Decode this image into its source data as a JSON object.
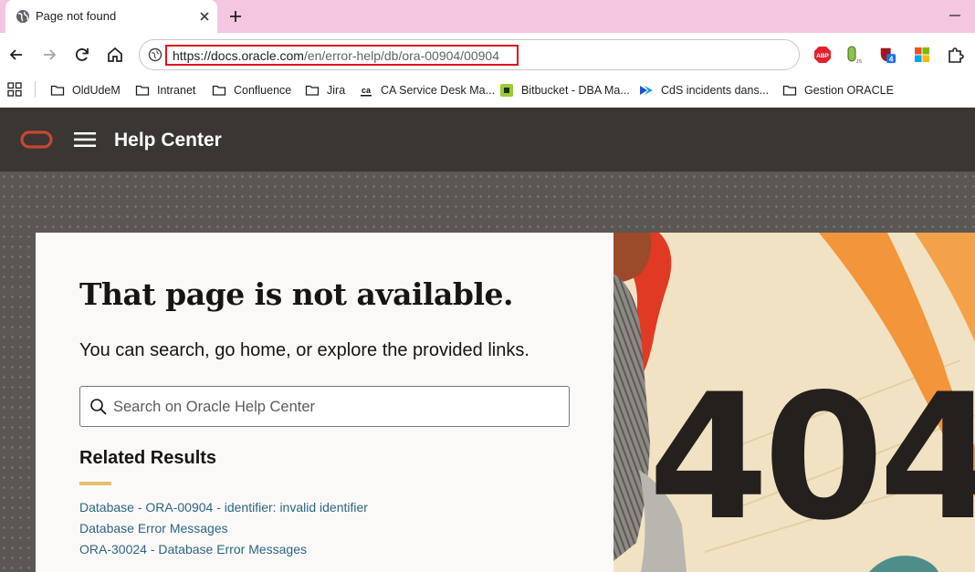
{
  "browser": {
    "tab": {
      "title": "Page not found"
    },
    "address_bar": {
      "url_host": "https://docs.oracle.com",
      "url_path": "/en/error-help/db/ora-00904/00904"
    },
    "bookmarks": [
      {
        "label": "OldUdeM",
        "icon": "folder-icon"
      },
      {
        "label": "Intranet",
        "icon": "folder-icon"
      },
      {
        "label": "Confluence",
        "icon": "folder-icon"
      },
      {
        "label": "Jira",
        "icon": "folder-icon"
      },
      {
        "label": "CA Service Desk Ma...",
        "icon": "ca-icon"
      },
      {
        "label": "Bitbucket - DBA Ma...",
        "icon": "bitbucket-icon"
      },
      {
        "label": "CdS incidents dans...",
        "icon": "cds-icon"
      },
      {
        "label": "Gestion ORACLE",
        "icon": "folder-icon"
      }
    ],
    "extensions": [
      {
        "name": "adblock-plus-icon",
        "label": "ABP"
      },
      {
        "name": "node-js-extension-icon",
        "label": "JS"
      },
      {
        "name": "shield-extension-icon",
        "badge": "4"
      },
      {
        "name": "microsoft-icon"
      },
      {
        "name": "extensions-puzzle-icon"
      }
    ]
  },
  "site": {
    "header_title": "Help Center"
  },
  "error_page": {
    "headline": "That page is not available.",
    "subline": "You can search, go home, or explore the provided links.",
    "search_placeholder": "Search on Oracle Help Center",
    "related_title": "Related Results",
    "related_links": [
      "Database - ORA-00904 - identifier: invalid identifier",
      "Database Error Messages",
      "ORA-30024 - Database Error Messages"
    ],
    "illustration_text": "404"
  },
  "colors": {
    "tabstrip": "#f4c6df",
    "oracle_red": "#c74634",
    "header_bg": "#3a3632",
    "link": "#2b6781",
    "accent_bar": "#e2c06d",
    "highlight_box": "#e0141e"
  }
}
